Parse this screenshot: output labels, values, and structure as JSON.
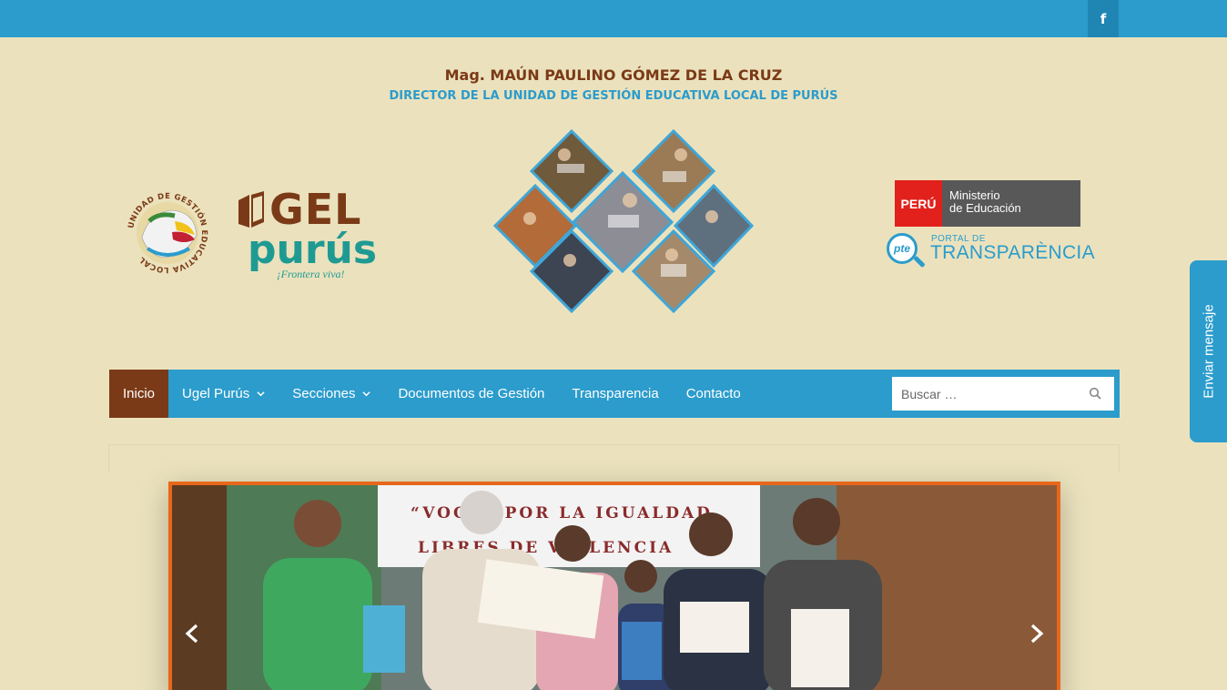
{
  "topbar": {
    "facebook_label": "f",
    "facebook_icon": "facebook-icon"
  },
  "header": {
    "director_name": "Mag. MAÚN PAULINO GÓMEZ DE LA CRUZ",
    "director_title": "DIRECTOR DE LA UNIDAD DE GESTIÓN EDUCATIVA LOCAL DE PURÚS",
    "seal_text_top": "UNIDAD DE GESTIÓN EDUCATIVA LOCAL",
    "ugel_logo": {
      "ugel": "GEL",
      "purus": "purús",
      "tagline": "¡Frontera viva!"
    },
    "ministry": {
      "peru": "PERÚ",
      "line1": "Ministerio",
      "line2": "de Educación"
    },
    "transparency": {
      "badge": "pte",
      "sub": "PORTAL DE",
      "main": "TRANSPARÈNCIA"
    }
  },
  "nav": {
    "items": [
      {
        "label": "Inicio",
        "active": true,
        "dropdown": false
      },
      {
        "label": "Ugel Purús",
        "active": false,
        "dropdown": true
      },
      {
        "label": "Secciones",
        "active": false,
        "dropdown": true
      },
      {
        "label": "Documentos de Gestión",
        "active": false,
        "dropdown": false
      },
      {
        "label": "Transparencia",
        "active": false,
        "dropdown": false
      },
      {
        "label": "Contacto",
        "active": false,
        "dropdown": false
      }
    ],
    "search_placeholder": "Buscar …"
  },
  "slider": {
    "banner_text_line1": "“VOCES POR LA IGUALDAD",
    "banner_text_line2": "LIBRES DE VIOLENCIA"
  },
  "side_tab": {
    "label": "Enviar mensaje"
  },
  "colors": {
    "primary": "#2b9ccc",
    "accent": "#7b3a17",
    "background": "#ebe2bd",
    "slider_border": "#e8671b"
  }
}
